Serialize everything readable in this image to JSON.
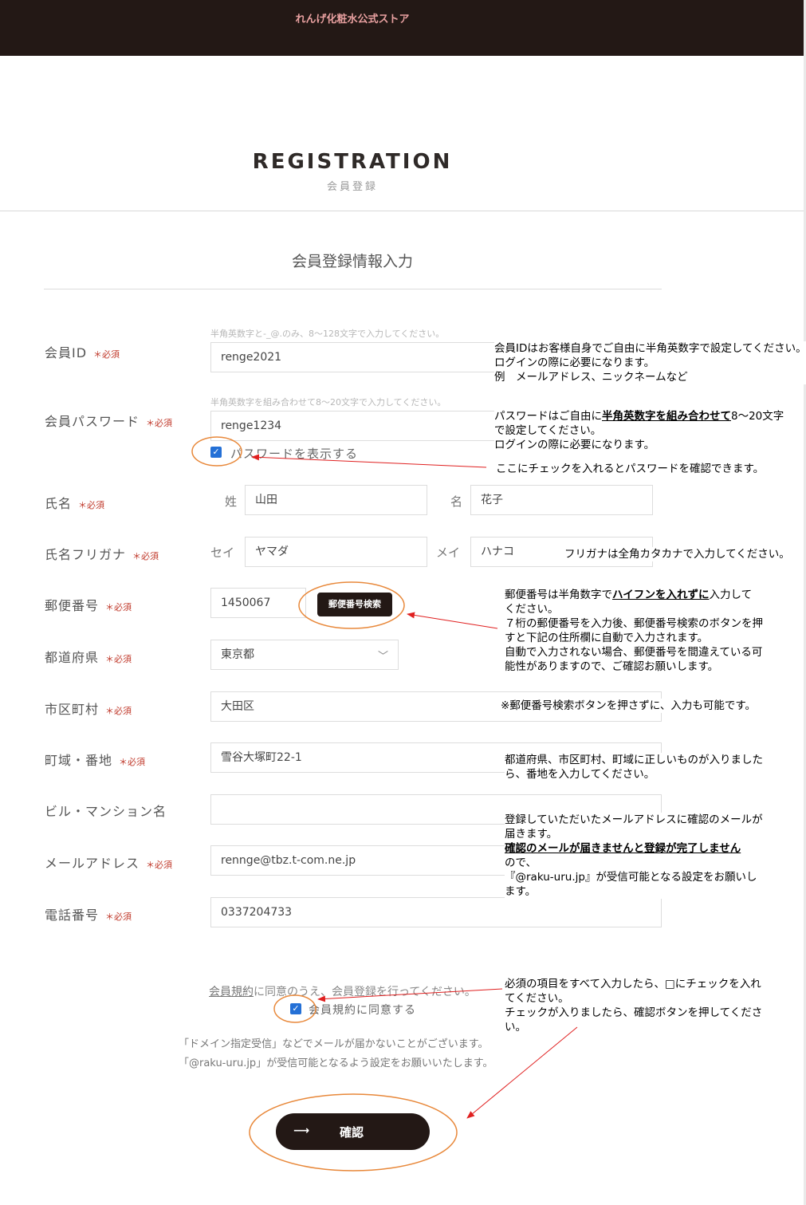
{
  "header": {
    "store_name": "れんげ化粧水公式ストア"
  },
  "page": {
    "title": "REGISTRATION",
    "subtitle": "会員登録",
    "section_title": "会員登録情報入力"
  },
  "required_mark": "＊必須",
  "fields": {
    "member_id": {
      "label": "会員ID",
      "hint": "半角英数字と-_@.のみ、8〜128文字で入力してください。",
      "value": "renge2021"
    },
    "password": {
      "label": "会員パスワード",
      "hint": "半角英数字を組み合わせて8〜20文字で入力してください。",
      "value": "renge1234",
      "show_label": "パスワードを表示する"
    },
    "name": {
      "label": "氏名",
      "sei_label": "姓",
      "sei_value": "山田",
      "mei_label": "名",
      "mei_value": "花子"
    },
    "furigana": {
      "label": "氏名フリガナ",
      "sei_label": "セイ",
      "sei_value": "ヤマダ",
      "mei_label": "メイ",
      "mei_value": "ハナコ"
    },
    "postal": {
      "label": "郵便番号",
      "value": "1450067",
      "button": "郵便番号検索"
    },
    "prefecture": {
      "label": "都道府県",
      "value": "東京都"
    },
    "city": {
      "label": "市区町村",
      "value": "大田区"
    },
    "town": {
      "label": "町域・番地",
      "value": "雪谷大塚町22-1"
    },
    "building": {
      "label": "ビル・マンション名",
      "value": ""
    },
    "email": {
      "label": "メールアドレス",
      "value": "rennge@tbz.t-com.ne.jp"
    },
    "phone": {
      "label": "電話番号",
      "value": "0337204733"
    }
  },
  "terms": {
    "link": "会員規約",
    "text": "に同意のうえ、会員登録を行ってください。",
    "agree_label": "会員規約に同意する",
    "notice_1": "「ドメイン指定受信」などでメールが届かないことがございます。",
    "notice_2": "「@raku-uru.jp」が受信可能となるよう設定をお願いいたします。"
  },
  "confirm_button": {
    "arrow": "⟶",
    "label": "確認"
  },
  "annotations": {
    "id": [
      "会員IDはお客様自身でご自由に半角英数字で設定してください。",
      "ログインの際に必要になります。",
      "例　メールアドレス、ニックネームなど"
    ],
    "pw_pre": "パスワードはご自由に",
    "pw_bold": "半角英数字を組み合わせて",
    "pw_post": "8〜20文字",
    "pw_lines": [
      "で設定してください。",
      "ログインの際に必要になります。"
    ],
    "pw_check": "ここにチェックを入れるとパスワードを確認できます。",
    "furigana": "フリガナは全角カタカナで入力してください。",
    "zip_pre": "郵便番号は半角数字で",
    "zip_bold": "ハイフンを入れずに",
    "zip_post": "入力して",
    "zip_lines": [
      "ください。",
      "７桁の郵便番号を入力後、郵便番号検索のボタンを押",
      "すと下記の住所欄に自動で入力されます。",
      "自動で入力されない場合、郵便番号を間違えている可",
      "能性がありますので、ご確認お願いします。"
    ],
    "city_note": "※郵便番号検索ボタンを押さずに、入力も可能です。",
    "town_note": [
      "都道府県、市区町村、町域に正しいものが入りました",
      "ら、番地を入力してください。"
    ],
    "email_lines_a": [
      "登録していただいたメールアドレスに確認のメールが",
      "届きます。"
    ],
    "email_bold": "確認のメールが届きませんと登録が完了しません",
    "email_lines_b": [
      "ので、",
      "『@raku-uru.jp』が受信可能となる設定をお願いし",
      "ます。"
    ],
    "terms_note": [
      "必須の項目をすべて入力したら、□にチェックを入れ",
      "てください。",
      "チェックが入りましたら、確認ボタンを押してくださ",
      "い。"
    ]
  },
  "colors": {
    "header_bg": "#231815",
    "header_text": "#e8a0a0",
    "required": "#c0392b",
    "checkbox": "#2470d6",
    "callout_orange": "#e8883a",
    "arrow_red": "#e02020"
  }
}
